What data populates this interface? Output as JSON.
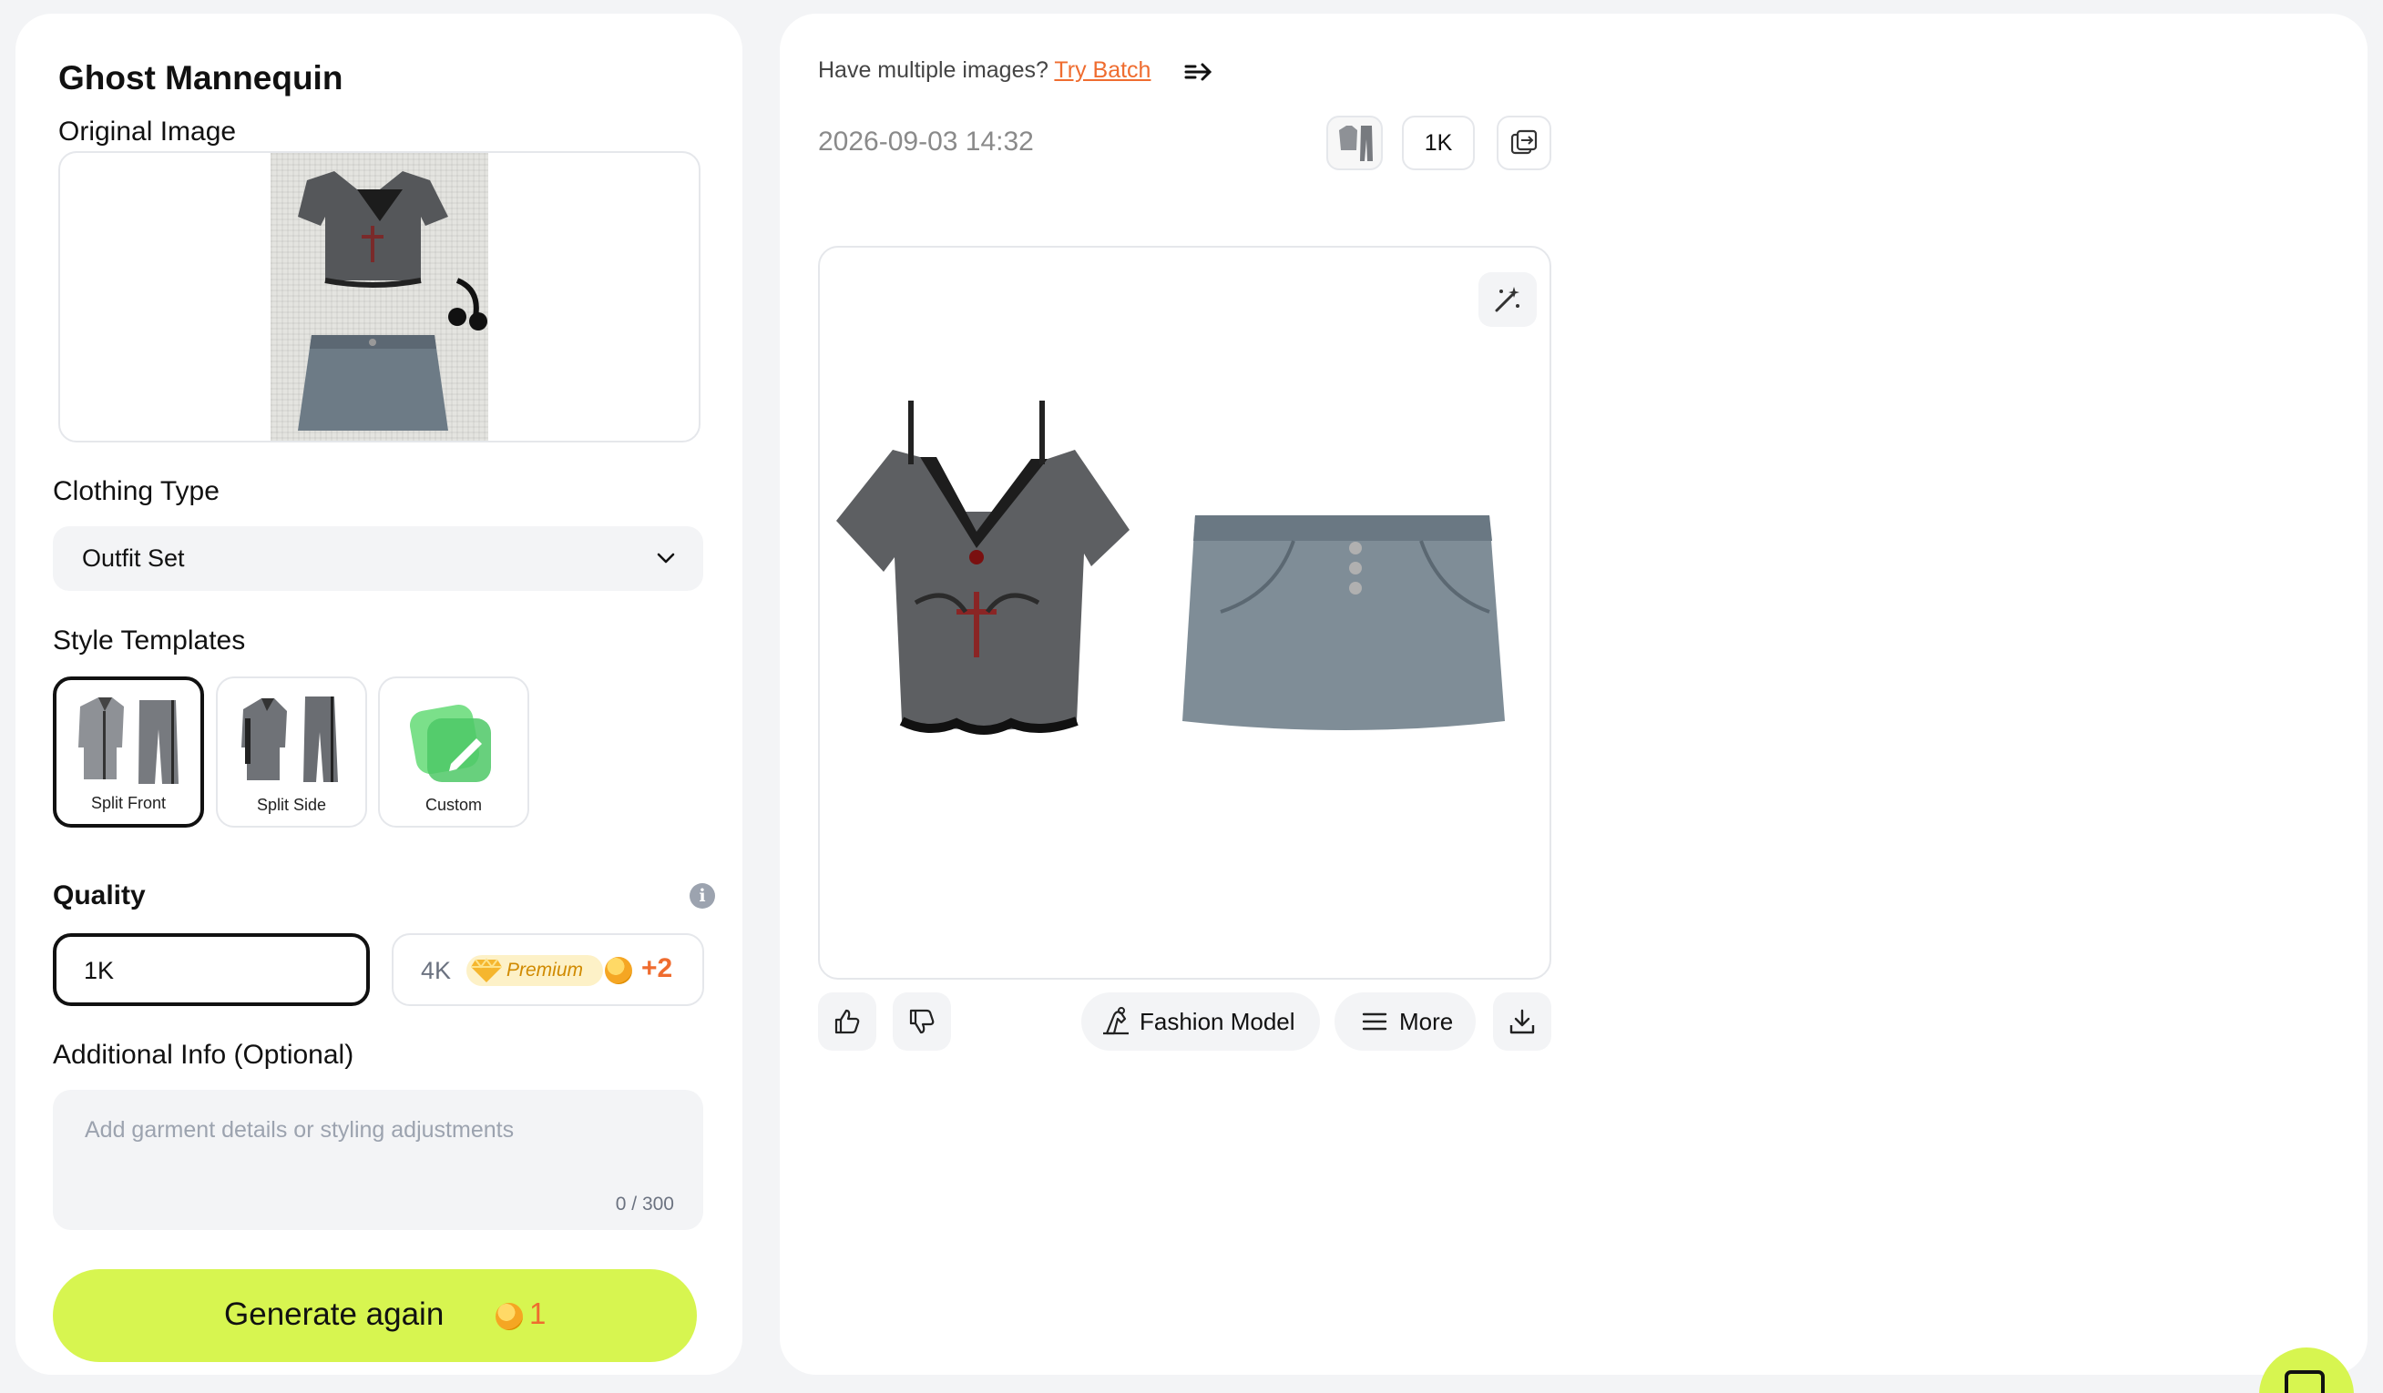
{
  "left": {
    "title": "Ghost Mannequin",
    "original_image_label": "Original Image",
    "clothing_type_label": "Clothing Type",
    "clothing_type_value": "Outfit Set",
    "style_templates_label": "Style Templates",
    "templates": [
      {
        "label": "Split Front",
        "selected": true
      },
      {
        "label": "Split Side",
        "selected": false
      },
      {
        "label": "Custom",
        "selected": false
      }
    ],
    "quality_label": "Quality",
    "quality_options": {
      "k1": "1K",
      "k4": "4K",
      "premium": "Premium",
      "extra_cost": "+2"
    },
    "additional_info_label": "Additional Info (Optional)",
    "additional_info_placeholder": "Add garment details or styling adjustments",
    "additional_info_count": "0 / 300",
    "generate_label": "Generate again",
    "generate_cost": "1"
  },
  "right": {
    "batch_prompt": "Have multiple images?",
    "batch_link": "Try Batch",
    "timestamp": "2026-09-03 14:32",
    "quality_chip": "1K",
    "actions": {
      "fashion_model": "Fashion Model",
      "more": "More"
    }
  },
  "colors": {
    "accent": "#d7f550",
    "link": "#ef6c2f",
    "premium": "#d08a00"
  }
}
